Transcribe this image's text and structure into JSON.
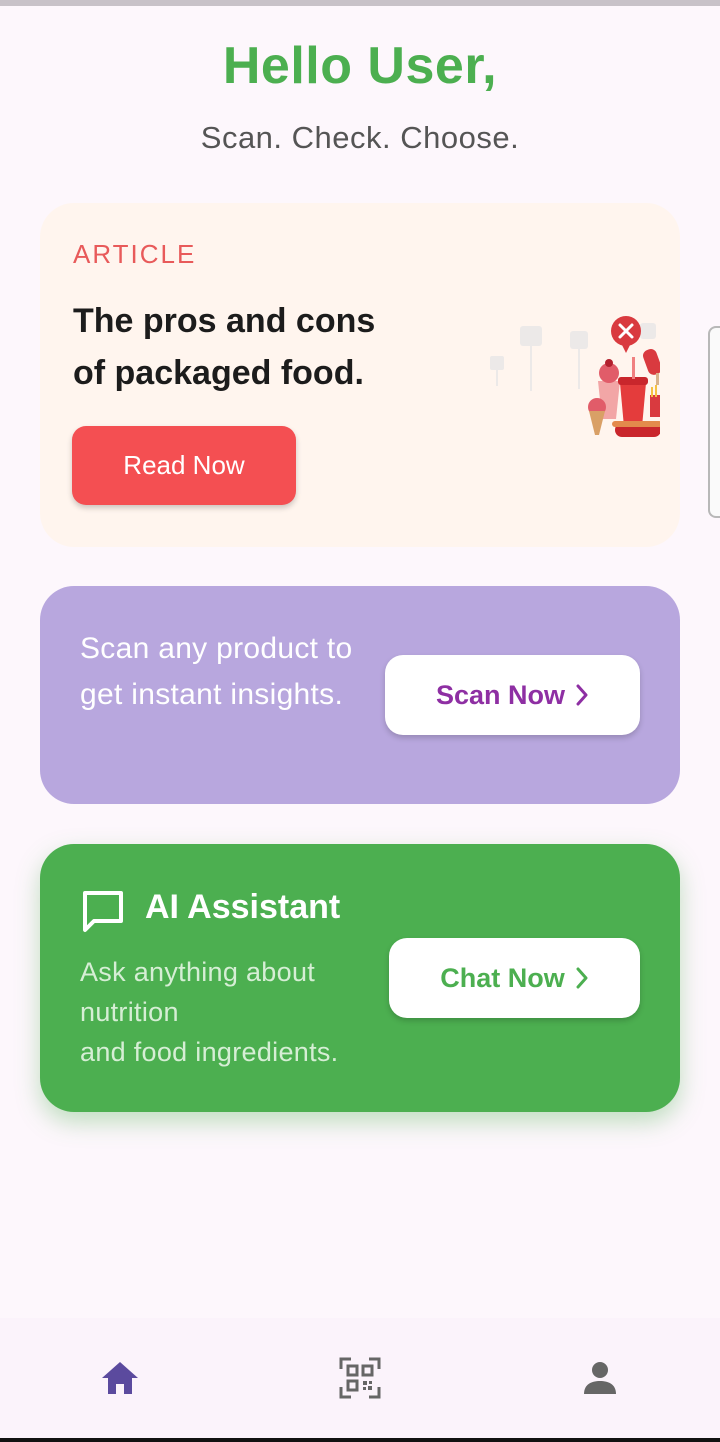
{
  "header": {
    "greeting": "Hello User,",
    "tagline": "Scan. Check. Choose."
  },
  "article_card": {
    "tag": "ARTICLE",
    "title": "The pros and cons of packaged food.",
    "button_label": "Read Now",
    "illustration": "junk-food-illustration"
  },
  "scan_card": {
    "description": "Scan any product to get instant insights.",
    "button_label": "Scan Now",
    "button_icon": "chevron-right-icon"
  },
  "ai_card": {
    "title": "AI Assistant",
    "icon": "chat-bubble-icon",
    "description": "Ask anything about nutrition\nand food ingredients.",
    "button_label": "Chat Now",
    "button_icon": "chevron-right-icon"
  },
  "bottom_nav": {
    "items": [
      {
        "name": "home",
        "icon": "home-icon",
        "active": true
      },
      {
        "name": "scan",
        "icon": "qr-scan-icon",
        "active": false
      },
      {
        "name": "profile",
        "icon": "person-icon",
        "active": false
      }
    ]
  },
  "colors": {
    "green": "#4caf50",
    "article_red": "#e85a5a",
    "read_button": "#f44f52",
    "lavender": "#b8a7de",
    "purple_text": "#8e2fa3",
    "nav_active": "#5b4a9e",
    "nav_inactive": "#666666"
  }
}
